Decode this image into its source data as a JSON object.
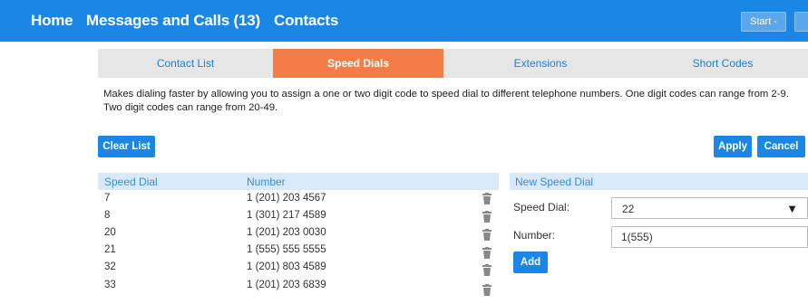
{
  "topnav": {
    "home": "Home",
    "messages": "Messages and Calls (13)",
    "contacts": "Contacts",
    "start_button": "Start -"
  },
  "tabs": [
    {
      "label": "Contact List",
      "active": false
    },
    {
      "label": "Speed Dials",
      "active": true
    },
    {
      "label": "Extensions",
      "active": false
    },
    {
      "label": "Short Codes",
      "active": false
    }
  ],
  "description": "Makes dialing faster by allowing you to assign a one or two digit code to speed dial to different telephone numbers. One digit codes can range from 2-9. Two digit codes can range from 20-49.",
  "buttons": {
    "clear_list": "Clear List",
    "apply": "Apply",
    "cancel": "Cancel",
    "add": "Add"
  },
  "table": {
    "headers": [
      "Speed Dial",
      "Number"
    ],
    "rows": [
      {
        "code": "7",
        "number": "1 (201) 203 4567"
      },
      {
        "code": "8",
        "number": "1 (301) 217 4589"
      },
      {
        "code": "20",
        "number": "1 (201) 203 0030"
      },
      {
        "code": "21",
        "number": "1 (555) 555 5555"
      },
      {
        "code": "32",
        "number": "1 (201) 803 4589"
      },
      {
        "code": "33",
        "number": "1 (201) 203 6839"
      }
    ]
  },
  "new_speed_dial": {
    "title": "New Speed Dial",
    "speed_dial_label": "Speed Dial:",
    "speed_dial_value": "22",
    "number_label": "Number:",
    "number_value": "1(555)"
  },
  "colors": {
    "topbar": "#1a86e6",
    "active_tab": "#f47c46",
    "table_header": "#d8e9f9",
    "button": "#1a86e6"
  },
  "icons": {
    "row_action": "trash-icon",
    "dropdown": "chevron-down-icon"
  }
}
